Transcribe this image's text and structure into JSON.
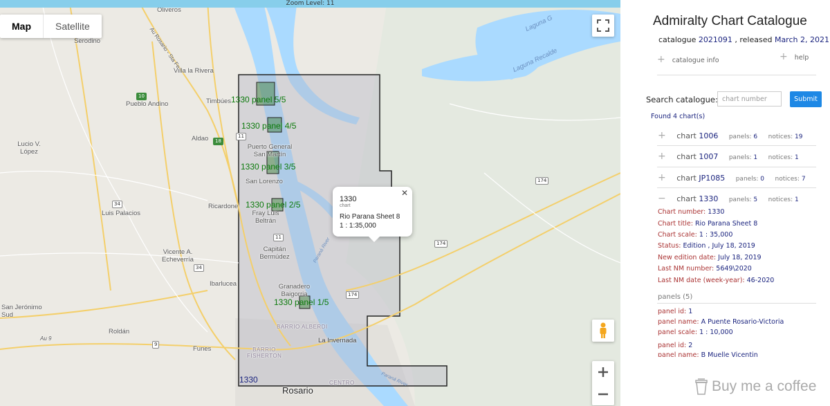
{
  "map": {
    "zoom_label": "Zoom Level: 11",
    "map_type": {
      "map": "Map",
      "satellite": "Satellite"
    },
    "places": [
      "Oliveros",
      "Serodino",
      "Villa la Rivera",
      "Pueblo Andino",
      "Timbúes",
      "Aldao",
      "Lucio V. López",
      "Puerto General San Martín",
      "San Lorenzo",
      "Ricardone",
      "Luis Palacios",
      "Fray Luis Beltrán",
      "Capitán Bermúdez",
      "Vicente A. Echeverría",
      "Ibarlucea",
      "Granadero Baigorria",
      "San Jerónimo Sud",
      "Roldán",
      "Funes",
      "La Invernada",
      "Rosario",
      "Laguna Recalde",
      "Laguna G"
    ],
    "districts": [
      "BARRIO ALBERDI",
      "BARRIO FISHERTON",
      "CENTRO"
    ],
    "roads": [
      "Au Rosario - Sta Fe",
      "Au 9",
      "Paraná River",
      "Paraná River"
    ],
    "route_shields": [
      "10",
      "18",
      "11",
      "34",
      "34",
      "11",
      "9",
      "174",
      "174",
      "174"
    ],
    "panels": [
      "1330 panel 5/5",
      "1330 panel 4/5",
      "1330 panel 3/5",
      "1330 panel 2/5",
      "1330 panel 1/5"
    ],
    "chart_outline_label": "1330",
    "popup": {
      "number": "1330",
      "sub": "chart",
      "title": "Rio Parana Sheet 8",
      "scale": "1 : 1:35,000"
    }
  },
  "sidebar": {
    "title": "Admiralty Chart Catalogue",
    "catalogue_prefix": "catalogue",
    "catalogue_id": "2021091",
    "released_prefix": ", released",
    "released_date": "March 2, 2021",
    "catalogue_info": "catalogue info",
    "help": "help",
    "search_label": "Search catalogue:",
    "search_placeholder": "chart number",
    "submit": "Submit",
    "found": "Found 4 chart(s)",
    "charts": [
      {
        "label": "chart",
        "number": "1006",
        "panels_label": "panels:",
        "panels": "6",
        "notices_label": "notices:",
        "notices": "19"
      },
      {
        "label": "chart",
        "number": "1007",
        "panels_label": "panels:",
        "panels": "1",
        "notices_label": "notices:",
        "notices": "1"
      },
      {
        "label": "chart",
        "number": "JP1085",
        "panels_label": "panels:",
        "panels": "0",
        "notices_label": "notices:",
        "notices": "7"
      },
      {
        "label": "chart",
        "number": "1330",
        "panels_label": "panels:",
        "panels": "5",
        "notices_label": "notices:",
        "notices": "1"
      }
    ],
    "details": [
      {
        "k": "Chart number:",
        "v": "1330"
      },
      {
        "k": "Chart title:",
        "v": "Rio Parana Sheet 8"
      },
      {
        "k": "Chart scale:",
        "v": "1 : 35,000"
      },
      {
        "k": "Status:",
        "v": "Edition , July 18, 2019"
      },
      {
        "k": "New edition date:",
        "v": "July 18, 2019"
      },
      {
        "k": "Last NM number:",
        "v": "5649\\2020"
      },
      {
        "k": "Last NM date (week-year):",
        "v": "46-2020"
      }
    ],
    "panels_head": "panels (5)",
    "panel_details": [
      {
        "k": "panel id:",
        "v": "1"
      },
      {
        "k": "panel name:",
        "v": "A Puente Rosario-Victoria"
      },
      {
        "k": "panel scale:",
        "v": "1 : 10,000"
      },
      {
        "k": "panel id:",
        "v": "2"
      },
      {
        "k": "panel name:",
        "v": "B Muelle Vicentin"
      }
    ],
    "coffee": "Buy me a coffee"
  },
  "colors": {
    "water": "#aadaff",
    "zoombar": "#87ceeb",
    "submit": "#1e88e5",
    "link": "#1a237e",
    "detail_key": "#aa3333",
    "panel_green": "#0b7a0b"
  }
}
